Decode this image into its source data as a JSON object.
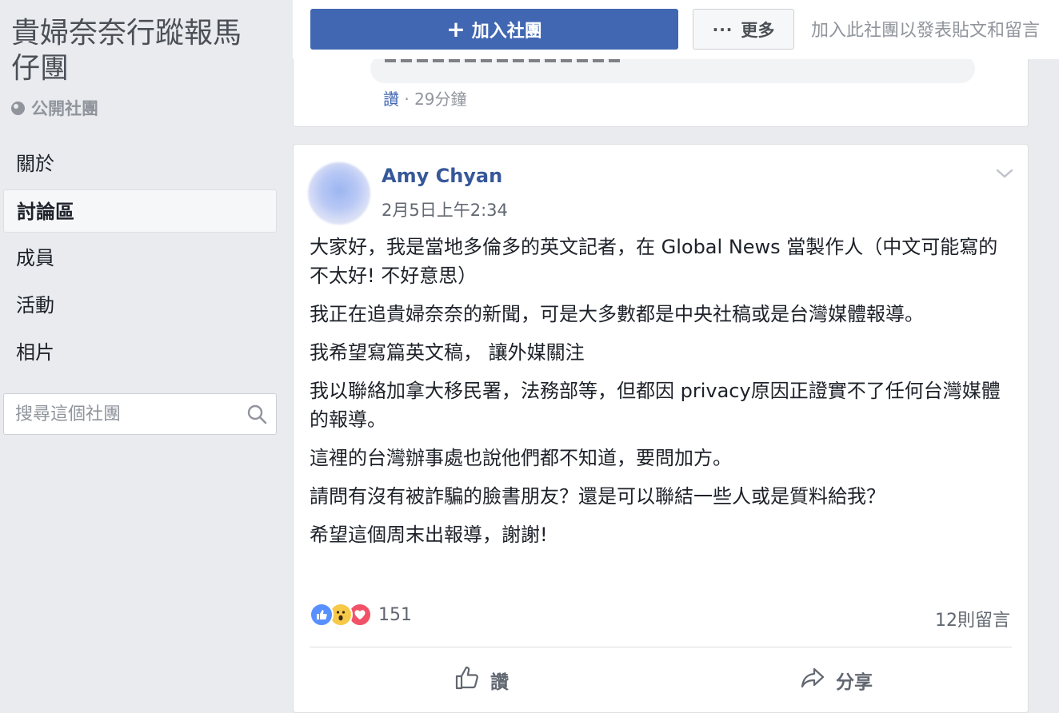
{
  "sidebar": {
    "group_title": "貴婦奈奈行蹤報馬仔團",
    "privacy": "公開社團",
    "nav_items": [
      {
        "label": "關於"
      },
      {
        "label": "討論區"
      },
      {
        "label": "成員"
      },
      {
        "label": "活動"
      },
      {
        "label": "相片"
      }
    ],
    "active_nav": "討論區",
    "search_placeholder": "搜尋這個社團"
  },
  "topbar": {
    "join_label": "加入社團",
    "more_label": "更多",
    "join_hint": "加入此社團以發表貼文和留言"
  },
  "prev_post": {
    "like_label": "讚",
    "separator": " · ",
    "time": "29分鐘"
  },
  "post": {
    "author": "Amy Chyan",
    "timestamp": "2月5日上午2:34",
    "paragraphs": [
      "大家好，我是當地多倫多的英文記者，在 Global News 當製作人（中文可能寫的不太好! 不好意思）",
      "我正在追貴婦奈奈的新聞，可是大多數都是中央社稿或是台灣媒體報導。",
      "我希望寫篇英文稿， 讓外媒關注",
      "我以聯絡加拿大移民署，法務部等，但都因 privacy原因正證實不了任何台灣媒體的報導。",
      "這裡的台灣辦事處也說他們都不知道，要問加方。",
      "請問有沒有被詐騙的臉書朋友？還是可以聯結一些人或是質料給我？",
      "希望這個周末出報導，謝謝!"
    ],
    "reactions_count": "151",
    "reaction_types": [
      "like-icon",
      "wow-icon",
      "love-icon"
    ],
    "comments_count": "12則留言",
    "like_action": "讚",
    "share_action": "分享"
  },
  "colors": {
    "brand_blue": "#4267b2",
    "link_blue": "#365899",
    "background": "#e9ebee"
  }
}
